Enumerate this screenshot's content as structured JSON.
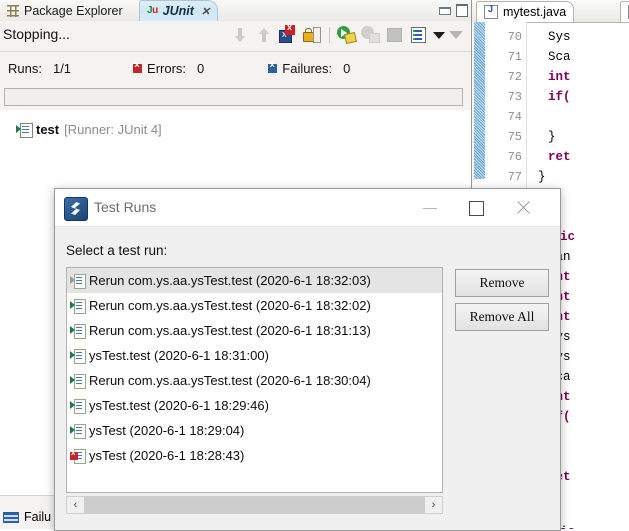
{
  "junit_view": {
    "tabs": [
      {
        "label": "Package Explorer",
        "icon": "package-explorer-icon",
        "active": false
      },
      {
        "label": "JUnit",
        "icon": "junit-icon",
        "active": true,
        "close": "✕"
      }
    ],
    "view_controls": {
      "minimize": "minimize-icon",
      "maximize": "maximize-icon"
    },
    "status_text": "Stopping...",
    "toolbar_icons": [
      "next-failure-icon",
      "previous-failure-icon",
      "show-failures-only-icon",
      "scroll-lock-icon",
      "rerun-test-icon",
      "rerun-test-failures-icon",
      "stop-test-run-icon",
      "test-run-history-icon",
      "view-menu-caret-icon",
      "view-minimize-icon"
    ],
    "stats": {
      "runs_label": "Runs:",
      "runs_value": "1/1",
      "errors_label": "Errors:",
      "errors_value": "0",
      "errors_color": "#c0272d",
      "failures_label": "Failures:",
      "failures_value": "0",
      "failures_color": "#2c5fa0"
    },
    "tree": {
      "icon": "test-run-icon",
      "name": "test",
      "meta": "[Runner: JUnit 4]"
    },
    "bottom_tab": {
      "icon": "failure-trace-icon",
      "label": "Failu"
    }
  },
  "editor": {
    "tabs": [
      {
        "label": "mytest.java",
        "icon": "java-file-icon"
      },
      {
        "label": "",
        "icon": "java-file-icon"
      }
    ],
    "line_numbers": [
      "70",
      "71",
      "72",
      "73",
      "74",
      "75",
      "76",
      "77"
    ],
    "code_lines_top": [
      {
        "indent": 2,
        "text": "Sys",
        "kind": "plain"
      },
      {
        "indent": 2,
        "text": "Sca",
        "kind": "plain"
      },
      {
        "indent": 2,
        "text": "int",
        "kind": "keyword"
      },
      {
        "indent": 2,
        "text": "if(",
        "kind": "keyword"
      },
      {
        "indent": 0,
        "text": "",
        "kind": "plain"
      },
      {
        "indent": 2,
        "text": "}",
        "kind": "plain"
      },
      {
        "indent": 2,
        "text": "ret",
        "kind": "keyword"
      },
      {
        "indent": 1,
        "text": "}",
        "kind": "plain"
      }
    ],
    "code_lines_bottom": [
      {
        "indent": 0,
        "text": "public",
        "kind": "keyword"
      },
      {
        "indent": 2,
        "text": "Ran",
        "kind": "plain"
      },
      {
        "indent": 2,
        "text": "int",
        "kind": "keyword"
      },
      {
        "indent": 2,
        "text": "int",
        "kind": "keyword"
      },
      {
        "indent": 2,
        "text": "int",
        "kind": "keyword"
      },
      {
        "indent": 2,
        "text": "Sys",
        "kind": "plain"
      },
      {
        "indent": 2,
        "text": "Sys",
        "kind": "plain"
      },
      {
        "indent": 2,
        "text": "Sca",
        "kind": "plain"
      },
      {
        "indent": 2,
        "text": "int",
        "kind": "keyword"
      },
      {
        "indent": 2,
        "text": "if(",
        "kind": "keyword"
      },
      {
        "indent": 0,
        "text": "",
        "kind": "plain"
      },
      {
        "indent": 2,
        "text": "}",
        "kind": "plain"
      },
      {
        "indent": 2,
        "text": "ret",
        "kind": "keyword"
      },
      {
        "indent": 0,
        "text": "}",
        "kind": "plain"
      },
      {
        "indent": 0,
        "text": "",
        "kind": "plain"
      },
      {
        "indent": 0,
        "text": "public",
        "kind": "keyword"
      }
    ],
    "keyword_color": "#7f0055"
  },
  "dialog": {
    "icon": "test-runs-icon",
    "title": "Test Runs",
    "window_buttons": {
      "minimize": "minimize-icon",
      "maximize": "maximize-icon",
      "close": "close-icon"
    },
    "prompt": "Select a test run:",
    "items": [
      {
        "icon": "test-run-gray-icon",
        "label": "Rerun com.ys.aa.ysTest.test (2020-6-1 18:32:03)",
        "selected": true
      },
      {
        "icon": "test-run-ok-icon",
        "label": "Rerun com.ys.aa.ysTest.test (2020-6-1 18:32:02)",
        "selected": false
      },
      {
        "icon": "test-run-ok-icon",
        "label": "Rerun com.ys.aa.ysTest.test (2020-6-1 18:31:13)",
        "selected": false
      },
      {
        "icon": "test-run-ok-icon",
        "label": "ysTest.test (2020-6-1 18:31:00)",
        "selected": false
      },
      {
        "icon": "test-run-ok-icon",
        "label": "Rerun com.ys.aa.ysTest.test (2020-6-1 18:30:04)",
        "selected": false
      },
      {
        "icon": "test-run-ok-icon",
        "label": "ysTest.test (2020-6-1 18:29:46)",
        "selected": false
      },
      {
        "icon": "test-run-ok-icon",
        "label": "ysTest (2020-6-1 18:29:04)",
        "selected": false
      },
      {
        "icon": "test-run-error-icon",
        "label": "ysTest (2020-6-1 18:28:43)",
        "selected": false
      }
    ],
    "scroll_left": "‹",
    "scroll_right": "›",
    "buttons": {
      "remove": "Remove",
      "remove_all": "Remove All"
    }
  }
}
